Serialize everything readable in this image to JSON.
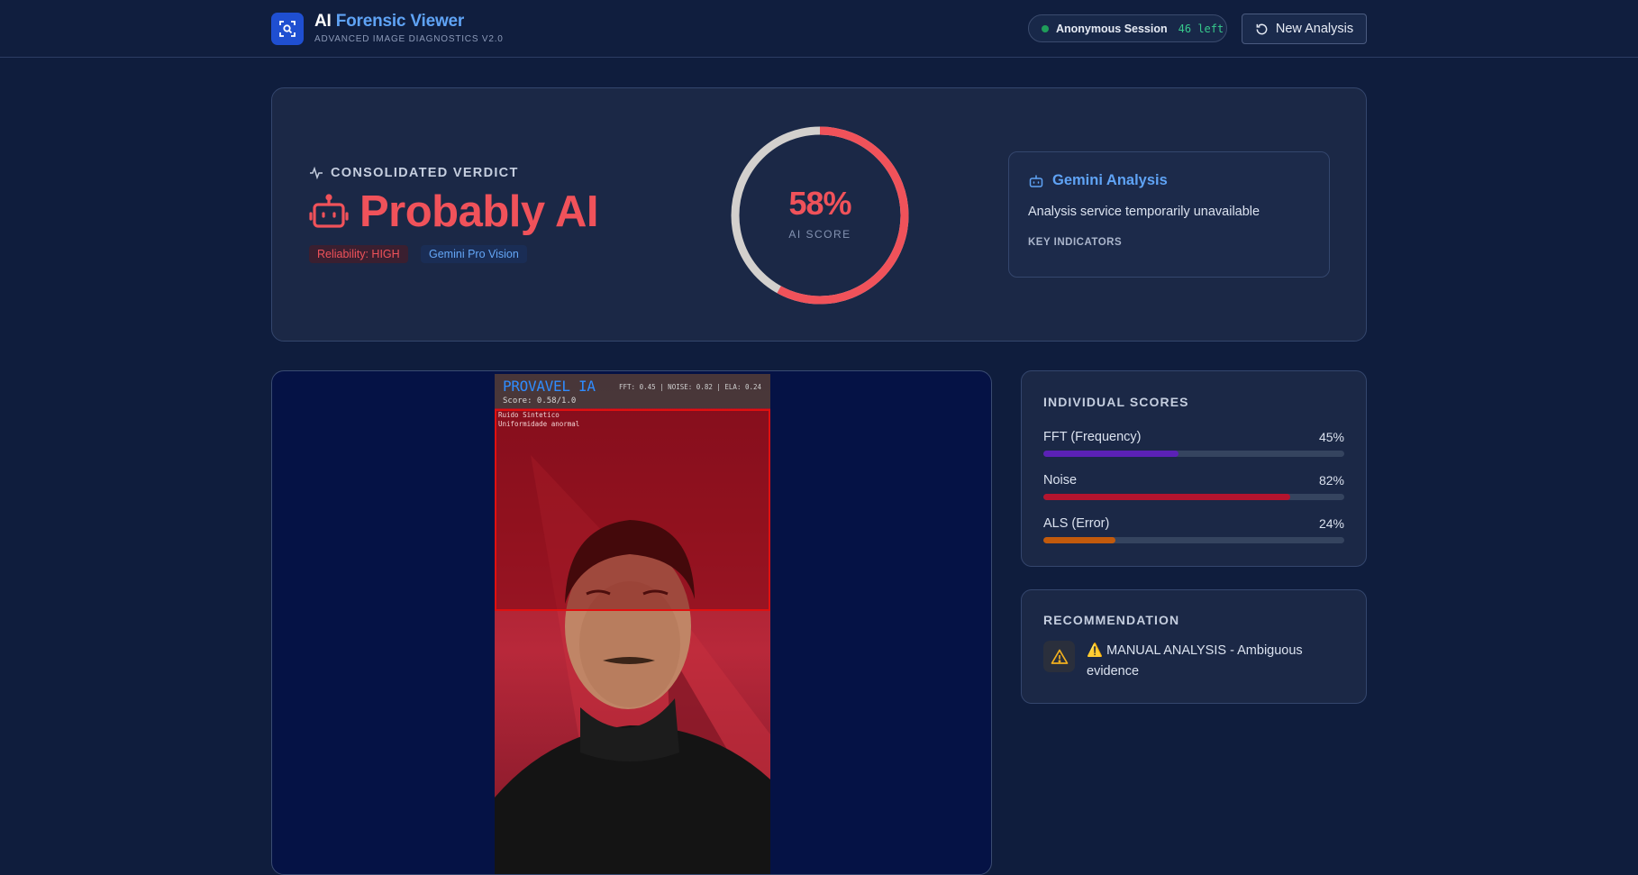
{
  "header": {
    "title_prefix": "AI",
    "title_main": "Forensic Viewer",
    "subtitle": "ADVANCED IMAGE DIAGNOSTICS V2.0",
    "session_label": "Anonymous Session",
    "session_left": "46 left",
    "new_analysis_label": "New Analysis"
  },
  "verdict": {
    "label": "CONSOLIDATED VERDICT",
    "text": "Probably AI",
    "reliability_badge": "Reliability: HIGH",
    "model_badge": "Gemini Pro Vision",
    "score_value": "58%",
    "score_fraction": 0.58,
    "score_label": "AI SCORE",
    "accent_color": "#f0525a"
  },
  "gemini": {
    "title": "Gemini Analysis",
    "status": "Analysis service temporarily unavailable",
    "indicators_heading": "KEY INDICATORS"
  },
  "image_overlay": {
    "title": "PROVAVEL IA",
    "metrics": "FFT: 0.45 | NOISE: 0.82 | ELA: 0.24",
    "score": "Score: 0.58/1.0",
    "roi_labels": [
      "Ruido Sintetico",
      "Uniformidade anormal"
    ]
  },
  "scores": {
    "heading": "INDIVIDUAL SCORES",
    "items": [
      {
        "name": "FFT (Frequency)",
        "pct": "45%",
        "fraction": 0.45,
        "color": "#5b21b6"
      },
      {
        "name": "Noise",
        "pct": "82%",
        "fraction": 0.82,
        "color": "#b3142e"
      },
      {
        "name": "ALS (Error)",
        "pct": "24%",
        "fraction": 0.24,
        "color": "#c25a0c"
      }
    ]
  },
  "recommendation": {
    "heading": "RECOMMENDATION",
    "text": "⚠️ MANUAL ANALYSIS - Ambiguous evidence"
  }
}
